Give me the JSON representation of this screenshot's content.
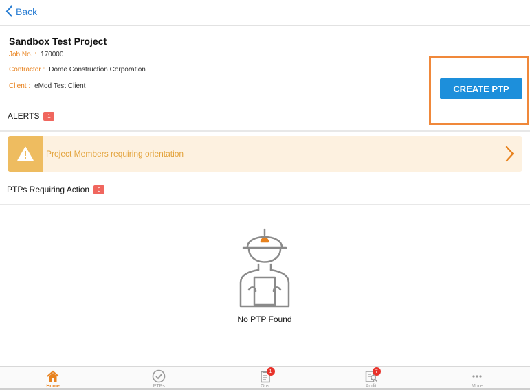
{
  "nav": {
    "back_label": "Back"
  },
  "project": {
    "title": "Sandbox Test Project",
    "job_label": "Job No. :",
    "job_value": "170000",
    "contractor_label": "Contractor :",
    "contractor_value": "Dome Construction Corporation",
    "client_label": "Client :",
    "client_value": "eMod Test Client"
  },
  "create_ptp_label": "CREATE PTP",
  "alerts": {
    "label": "ALERTS",
    "count": "1",
    "items": [
      {
        "text": "Project Members requiring orientation"
      }
    ]
  },
  "ptps_requiring_action": {
    "label": "PTPs Requiring Action",
    "count": "0"
  },
  "empty_state": {
    "text": "No PTP Found"
  },
  "tabbar": {
    "tabs": [
      {
        "label": "Home",
        "icon": "home-icon",
        "active": true
      },
      {
        "label": "PTPs",
        "icon": "check-circle-icon"
      },
      {
        "label": "Obs",
        "icon": "clipboard-icon",
        "badge": "1"
      },
      {
        "label": "Audit",
        "icon": "audit-search-icon",
        "badge": "7"
      },
      {
        "label": "More",
        "icon": "more-dots-icon"
      }
    ]
  },
  "colors": {
    "accent": "#e8821e",
    "primary_button": "#1d8fdb",
    "alert_bg": "#fdf1e0",
    "badge": "#f0665e",
    "highlight_frame": "#f0883a"
  }
}
